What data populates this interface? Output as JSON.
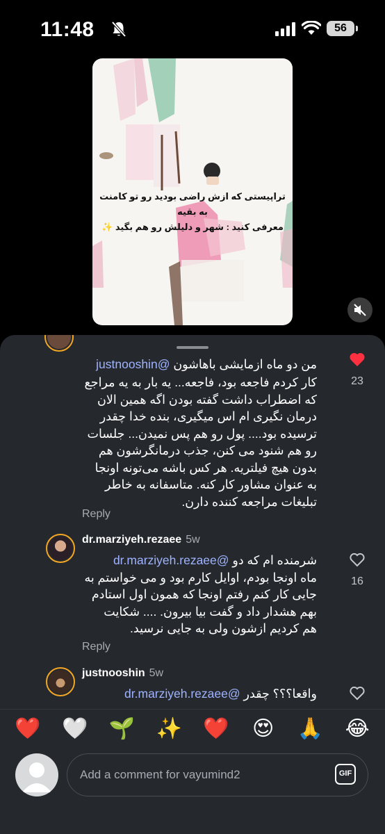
{
  "status_bar": {
    "time": "11:48",
    "battery": "56"
  },
  "story": {
    "line1": "تراپیستی که ازش راضی بودید رو تو کامنت به بقیه",
    "line2": "معرفی کنید : شهر و دلیلش رو هم بگید ✨"
  },
  "comments": [
    {
      "mention": "@justnooshin",
      "top_partial": "من دو ماه ازمایشی باهاشون",
      "lines": [
        "کار کردم فاجعه بود، فاجعه... یه بار به یه مراجع",
        "که اضطراب داشت گفته بودن اگه همین الان",
        "درمان نگیری ام اس میگیری، بنده خدا چقدر",
        "ترسیده بود.... پول رو هم پس نمیدن... جلسات",
        "رو هم شنود می کنن، جذب درمانگرشون هم",
        "بدون هیچ فیلتریه. هر کس باشه می‌تونه اونجا",
        "به عنوان مشاور کار کنه. متاسفانه به خاطر",
        "تبلیغات مراجعه کننده دارن."
      ],
      "likes": "23",
      "reply_label": "Reply"
    },
    {
      "username": "dr.marziyeh.rezaee",
      "time": "5w",
      "mention": "@dr.marziyeh.rezaee",
      "first_text": "شرمنده ام که دو",
      "lines": [
        "ماه اونجا بودم، اوایل کارم بود و می خواستم به",
        "جایی کار کنم رفتم اونجا که همون اول استادم",
        "بهم هشدار داد و گفت بیا بیرون. .... شکایت",
        "هم کردیم ازشون ولی به جایی نرسید."
      ],
      "likes": "16",
      "reply_label": "Reply"
    },
    {
      "username": "justnooshin",
      "time": "5w",
      "mention": "@dr.marziyeh.rezaee",
      "first_text": "واقعا؟؟؟ چقدر"
    }
  ],
  "emojis": [
    "❤️",
    "🤍",
    "🌱",
    "✨",
    "❤️",
    "😍",
    "🙏",
    "😂"
  ],
  "input": {
    "placeholder": "Add a comment for vayumind2",
    "gif_label": "GIF"
  },
  "colors": {
    "sheet_bg": "#25292e",
    "mention": "#9fb3ff",
    "like_red": "#ff3040",
    "avatar_ring": "#f5a623"
  }
}
